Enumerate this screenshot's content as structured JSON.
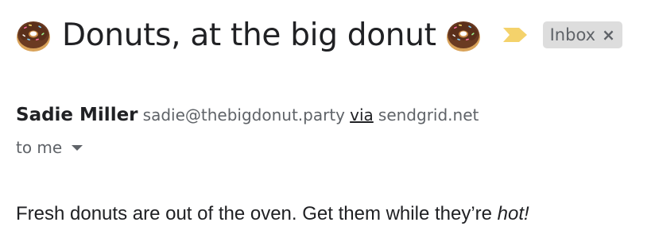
{
  "subject": {
    "emoji_left": "donut-icon",
    "text": "Donuts, at the big donut",
    "emoji_right": "donut-icon",
    "importance_marker": "importance-marker-icon",
    "importance_color": "#f4d26b",
    "label_chip": {
      "label": "Inbox",
      "close": "×"
    }
  },
  "sender": {
    "name": "Sadie Miller",
    "email": "sadie@thebigdonut.party",
    "via_label": "via",
    "via_domain": "sendgrid.net"
  },
  "recipient": {
    "label": "to me",
    "caret_icon": "caret-down-icon"
  },
  "body": {
    "text_before": "Fresh donuts are out of the oven. Get them while they’re ",
    "text_emphasis": "hot!"
  },
  "colors": {
    "text_primary": "#202124",
    "text_secondary": "#5f6368",
    "chip_background": "#dddddd"
  }
}
